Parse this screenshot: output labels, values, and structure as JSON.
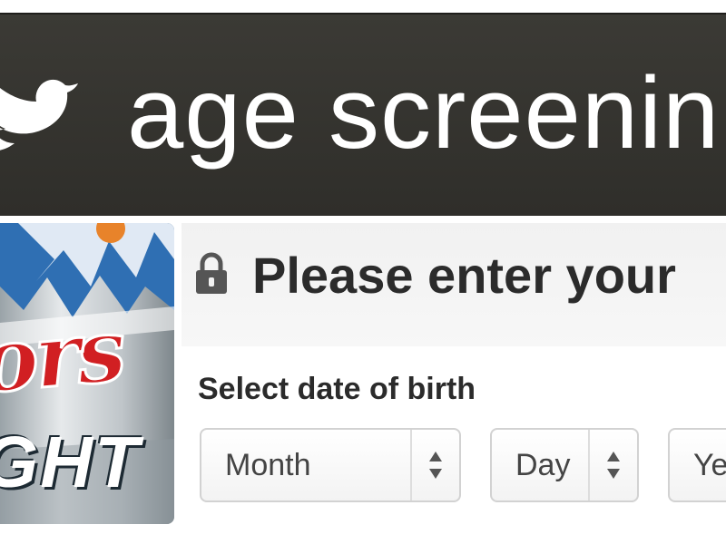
{
  "header": {
    "title": "age screenin",
    "logo_icon": "bird-icon"
  },
  "ad_image": {
    "brand_text": "ors",
    "sub_text": "GHT",
    "icon": "beer-can-image"
  },
  "form": {
    "lock_icon": "lock-icon",
    "headline": "Please enter your",
    "dob_label": "Select date of birth",
    "month_select": {
      "value": "Month",
      "icon": "select-arrows-icon"
    },
    "day_select": {
      "value": "Day",
      "icon": "select-arrows-icon"
    },
    "year_select": {
      "value": "Ye",
      "icon": "select-arrows-icon"
    }
  },
  "colors": {
    "header_bg": "#35342f",
    "text_dark": "#2b2b2b",
    "brand_red": "#d11f22"
  }
}
